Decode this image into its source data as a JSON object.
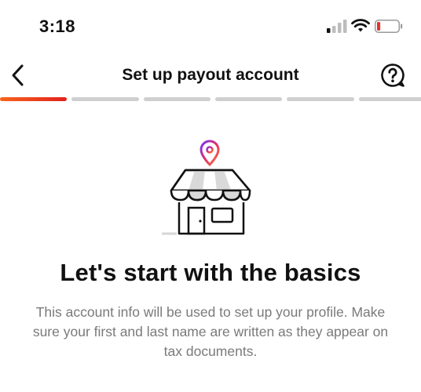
{
  "status_bar": {
    "time": "3:18",
    "icons": [
      "signal-icon",
      "wifi-icon",
      "battery-icon"
    ],
    "battery_level": 0.12,
    "battery_color": "#e0342b"
  },
  "header": {
    "title": "Set up payout account",
    "back_icon": "chevron-left-icon",
    "help_icon": "help-bubble-icon"
  },
  "progress": {
    "total_steps": 6,
    "current_step": 1,
    "active_gradient": [
      "#f7631b",
      "#e2221d"
    ],
    "inactive_color": "#cfcfcf"
  },
  "illustration": {
    "icon": "storefront-icon",
    "pin_icon": "location-pin-icon",
    "pin_gradient": [
      "#7b2ff7",
      "#e1306c",
      "#f77737"
    ]
  },
  "content": {
    "heading": "Let's start with the basics",
    "description": "This account info will be used to set up your profile. Make sure your first and last name are written as they appear on tax documents."
  }
}
